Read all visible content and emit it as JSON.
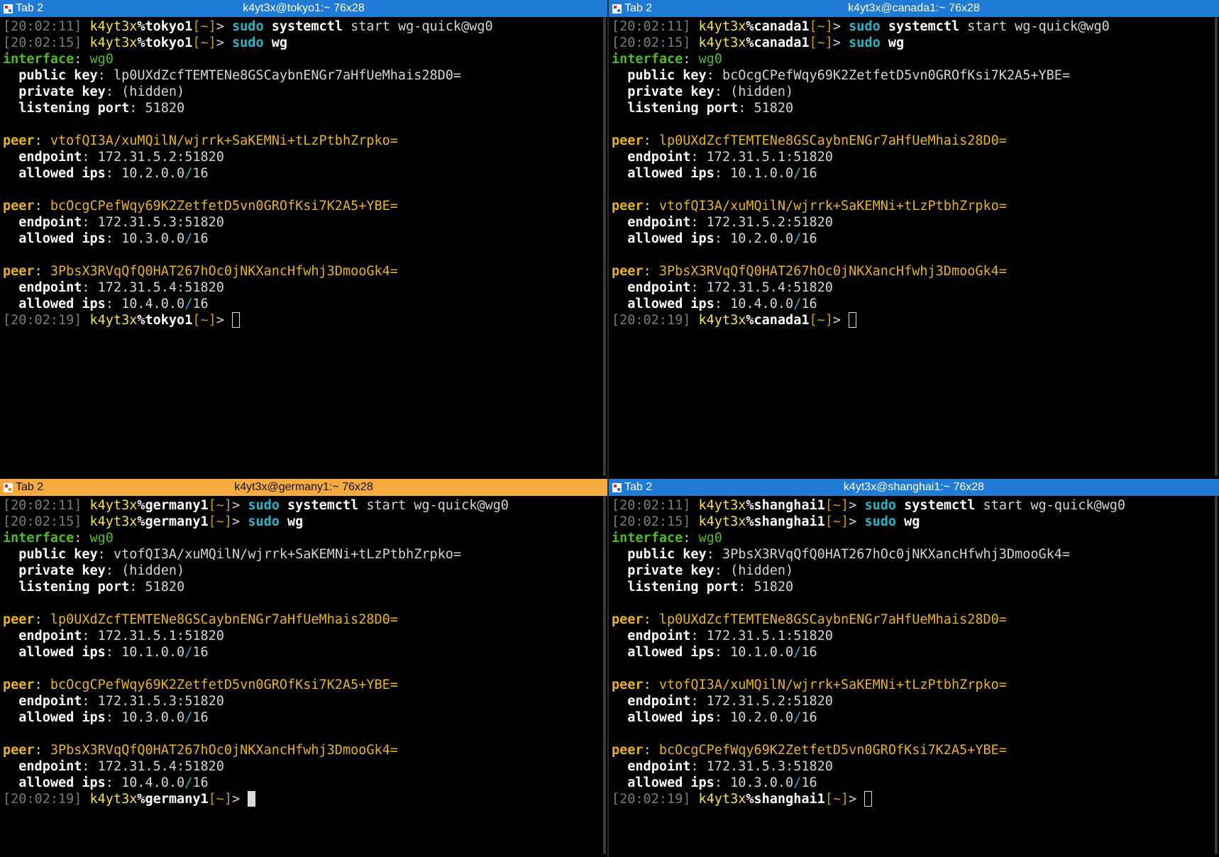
{
  "panes": [
    {
      "tab_label": "Tab 2",
      "title": "k4yt3x@tokyo1:~ 76x28",
      "active": false,
      "user": "k4yt3x",
      "host": "tokyo1",
      "path": "[~]",
      "prompt_symbol": ">",
      "commands": [
        {
          "time": "[20:02:11]",
          "sudo": "sudo",
          "bin": "systemctl",
          "args": " start wg-quick@wg0"
        },
        {
          "time": "[20:02:15]",
          "sudo": "sudo",
          "bin": "wg",
          "args": ""
        }
      ],
      "interface": {
        "label": "interface",
        "name": "wg0",
        "public_key": "lp0UXdZcfTEMTENe8GSCaybnENGr7aHfUeMhais28D0=",
        "private_key": "(hidden)",
        "listening_port": "51820"
      },
      "peers": [
        {
          "key": "vtofQI3A/xuMQilN/wjrrk+SaKEMNi+tLzPtbhZrpko=",
          "endpoint": "172.31.5.2:51820",
          "ip_a": "10.2.0.0",
          "ip_b": "16"
        },
        {
          "key": "bcOcgCPefWqy69K2ZetfetD5vn0GROfKsi7K2A5+YBE=",
          "endpoint": "172.31.5.3:51820",
          "ip_a": "10.3.0.0",
          "ip_b": "16"
        },
        {
          "key": "3PbsX3RVqQfQ0HAT267hOc0jNKXancHfwhj3DmooGk4=",
          "endpoint": "172.31.5.4:51820",
          "ip_a": "10.4.0.0",
          "ip_b": "16"
        }
      ],
      "last_time": "[20:02:19]"
    },
    {
      "tab_label": "Tab 2",
      "title": "k4yt3x@canada1:~ 76x28",
      "active": false,
      "user": "k4yt3x",
      "host": "canada1",
      "path": "[~]",
      "prompt_symbol": ">",
      "commands": [
        {
          "time": "[20:02:11]",
          "sudo": "sudo",
          "bin": "systemctl",
          "args": " start wg-quick@wg0"
        },
        {
          "time": "[20:02:15]",
          "sudo": "sudo",
          "bin": "wg",
          "args": ""
        }
      ],
      "interface": {
        "label": "interface",
        "name": "wg0",
        "public_key": "bcOcgCPefWqy69K2ZetfetD5vn0GROfKsi7K2A5+YBE=",
        "private_key": "(hidden)",
        "listening_port": "51820"
      },
      "peers": [
        {
          "key": "lp0UXdZcfTEMTENe8GSCaybnENGr7aHfUeMhais28D0=",
          "endpoint": "172.31.5.1:51820",
          "ip_a": "10.1.0.0",
          "ip_b": "16"
        },
        {
          "key": "vtofQI3A/xuMQilN/wjrrk+SaKEMNi+tLzPtbhZrpko=",
          "endpoint": "172.31.5.2:51820",
          "ip_a": "10.2.0.0",
          "ip_b": "16"
        },
        {
          "key": "3PbsX3RVqQfQ0HAT267hOc0jNKXancHfwhj3DmooGk4=",
          "endpoint": "172.31.5.4:51820",
          "ip_a": "10.4.0.0",
          "ip_b": "16"
        }
      ],
      "last_time": "[20:02:19]"
    },
    {
      "tab_label": "Tab 2",
      "title": "k4yt3x@germany1:~ 76x28",
      "active": true,
      "user": "k4yt3x",
      "host": "germany1",
      "path": "[~]",
      "prompt_symbol": ">",
      "commands": [
        {
          "time": "[20:02:11]",
          "sudo": "sudo",
          "bin": "systemctl",
          "args": " start wg-quick@wg0"
        },
        {
          "time": "[20:02:15]",
          "sudo": "sudo",
          "bin": "wg",
          "args": ""
        }
      ],
      "interface": {
        "label": "interface",
        "name": "wg0",
        "public_key": "vtofQI3A/xuMQilN/wjrrk+SaKEMNi+tLzPtbhZrpko=",
        "private_key": "(hidden)",
        "listening_port": "51820"
      },
      "peers": [
        {
          "key": "lp0UXdZcfTEMTENe8GSCaybnENGr7aHfUeMhais28D0=",
          "endpoint": "172.31.5.1:51820",
          "ip_a": "10.1.0.0",
          "ip_b": "16"
        },
        {
          "key": "bcOcgCPefWqy69K2ZetfetD5vn0GROfKsi7K2A5+YBE=",
          "endpoint": "172.31.5.3:51820",
          "ip_a": "10.3.0.0",
          "ip_b": "16"
        },
        {
          "key": "3PbsX3RVqQfQ0HAT267hOc0jNKXancHfwhj3DmooGk4=",
          "endpoint": "172.31.5.4:51820",
          "ip_a": "10.4.0.0",
          "ip_b": "16"
        }
      ],
      "last_time": "[20:02:19]"
    },
    {
      "tab_label": "Tab 2",
      "title": "k4yt3x@shanghai1:~ 76x28",
      "active": false,
      "user": "k4yt3x",
      "host": "shanghai1",
      "path": "[~]",
      "prompt_symbol": ">",
      "commands": [
        {
          "time": "[20:02:11]",
          "sudo": "sudo",
          "bin": "systemctl",
          "args": " start wg-quick@wg0"
        },
        {
          "time": "[20:02:15]",
          "sudo": "sudo",
          "bin": "wg",
          "args": ""
        }
      ],
      "interface": {
        "label": "interface",
        "name": "wg0",
        "public_key": "3PbsX3RVqQfQ0HAT267hOc0jNKXancHfwhj3DmooGk4=",
        "private_key": "(hidden)",
        "listening_port": "51820"
      },
      "peers": [
        {
          "key": "lp0UXdZcfTEMTENe8GSCaybnENGr7aHfUeMhais28D0=",
          "endpoint": "172.31.5.1:51820",
          "ip_a": "10.1.0.0",
          "ip_b": "16"
        },
        {
          "key": "vtofQI3A/xuMQilN/wjrrk+SaKEMNi+tLzPtbhZrpko=",
          "endpoint": "172.31.5.2:51820",
          "ip_a": "10.2.0.0",
          "ip_b": "16"
        },
        {
          "key": "bcOcgCPefWqy69K2ZetfetD5vn0GROfKsi7K2A5+YBE=",
          "endpoint": "172.31.5.3:51820",
          "ip_a": "10.3.0.0",
          "ip_b": "16"
        }
      ],
      "last_time": "[20:02:19]"
    }
  ],
  "labels": {
    "public_key": "public key",
    "private_key": "private key",
    "listening_port": "listening port",
    "peer": "peer",
    "endpoint": "endpoint",
    "allowed_ips": "allowed ips",
    "colon": ":",
    "slash": "/"
  },
  "colors": {
    "titlebar": "#1f7bd6",
    "titlebar_active": "#f5a93e"
  }
}
